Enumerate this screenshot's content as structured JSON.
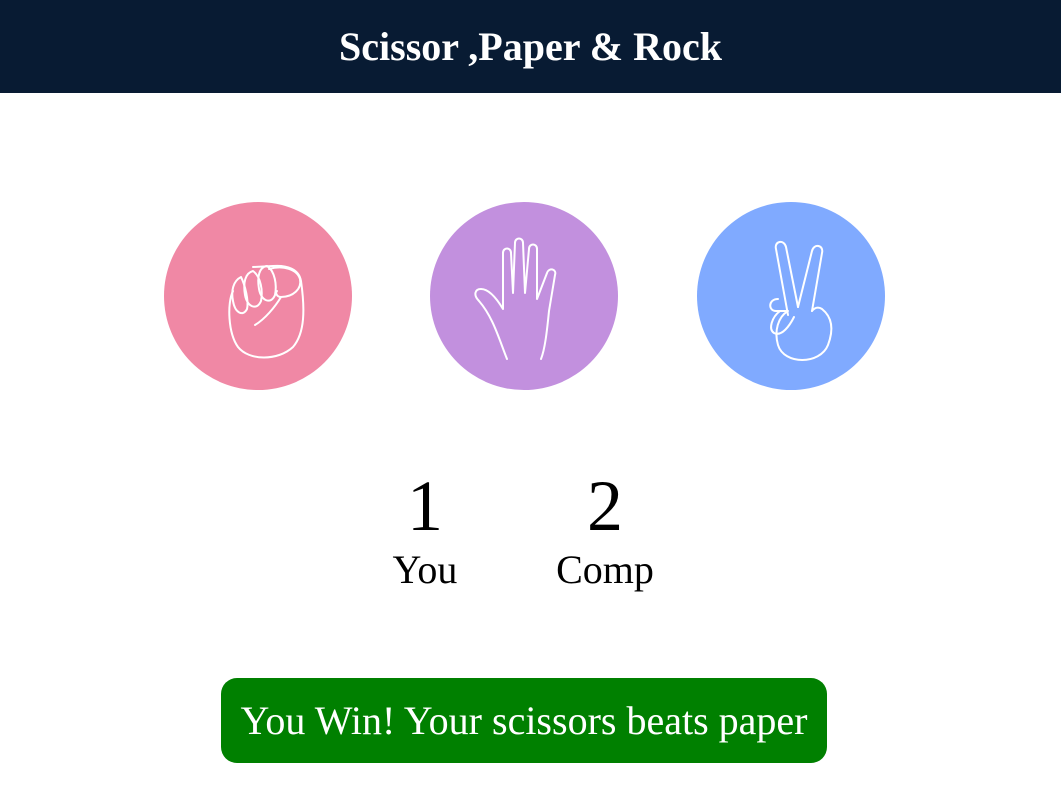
{
  "header": {
    "title": "Scissor ,Paper & Rock"
  },
  "choices": [
    {
      "name": "rock",
      "icon": "rock-fist-icon",
      "color": "#f088a5"
    },
    {
      "name": "paper",
      "icon": "open-hand-icon",
      "color": "#c290de"
    },
    {
      "name": "scissors",
      "icon": "peace-sign-hand-icon",
      "color": "#80aaff"
    }
  ],
  "score": {
    "user": {
      "value": "1",
      "label": "You"
    },
    "comp": {
      "value": "2",
      "label": "Comp"
    }
  },
  "message": {
    "text": "You Win! Your scissors beats paper",
    "color": "#008000"
  },
  "colors": {
    "header_bg": "#081b33",
    "text_on_dark": "#ffffff"
  }
}
